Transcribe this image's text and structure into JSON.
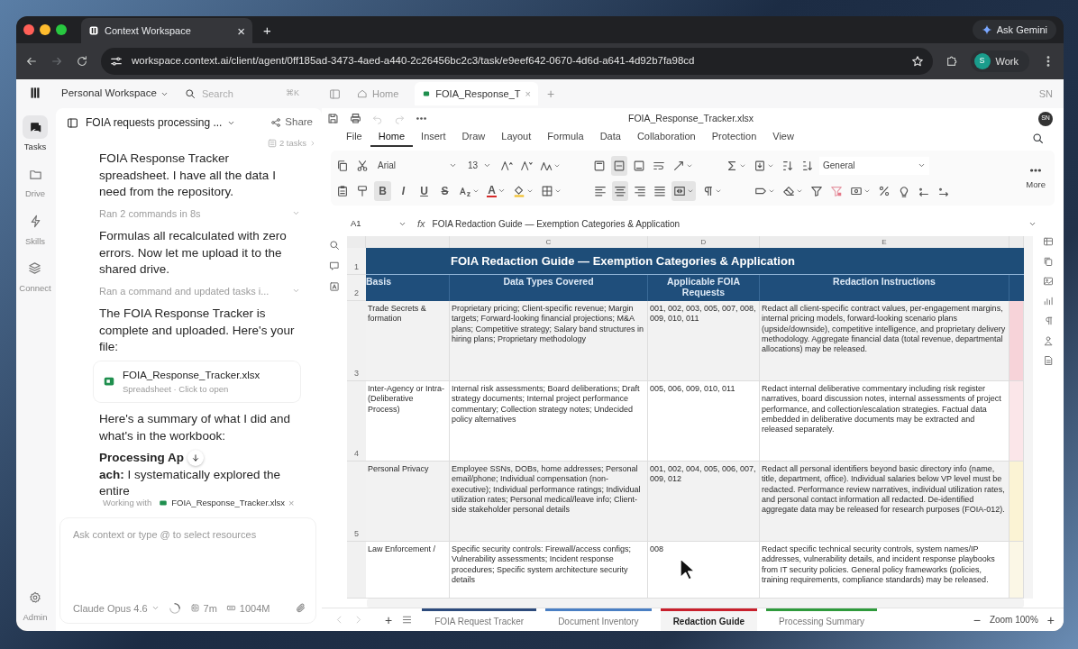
{
  "browser": {
    "tab_title": "Context Workspace",
    "tab_close": "×",
    "new_tab": "+",
    "gemini": "Ask Gemini",
    "url": "workspace.context.ai/client/agent/0ff185ad-3473-4aed-a440-2c26456bc2c3/task/e9eef642-0670-4d6d-a641-4d92b7fa98cd",
    "profile_initial": "S",
    "profile": "Work"
  },
  "rail": {
    "items": [
      {
        "label": "Tasks",
        "selected": true
      },
      {
        "label": "Drive",
        "selected": false
      },
      {
        "label": "Skills",
        "selected": false
      },
      {
        "label": "Connect",
        "selected": false
      }
    ],
    "admin": "Admin"
  },
  "workspace": {
    "name": "Personal Workspace",
    "search_placeholder": "Search",
    "shortcut": "⌘K"
  },
  "chat": {
    "title": "FOIA requests processing ...",
    "share": "Share",
    "tasks_chip": "2 tasks",
    "messages": [
      {
        "kind": "text",
        "text": "FOIA Response Tracker spreadsheet. I have all the data I need from the repository."
      },
      {
        "kind": "activity",
        "text": "Ran 2 commands in 8s"
      },
      {
        "kind": "text",
        "text": "Formulas all recalculated with zero errors. Now let me upload it to the shared drive."
      },
      {
        "kind": "activity",
        "text": "Ran a command and updated tasks i..."
      },
      {
        "kind": "text",
        "text": "The FOIA Response Tracker is complete and uploaded. Here's your file:"
      },
      {
        "kind": "file",
        "name": "FOIA_Response_Tracker.xlsx",
        "meta": "Spreadsheet · Click to open"
      },
      {
        "kind": "text",
        "text": "Here's a summary of what I did and what's in the workbook:"
      },
      {
        "kind": "split",
        "before": "**Processing Ap**",
        "after": "**ach:** I systematically explored the entire"
      }
    ],
    "context_label": "Working with",
    "context_file": "FOIA_Response_Tracker.xlsx",
    "context_close": "×",
    "input_placeholder": "Ask context or type @ to select resources",
    "model": "Claude Opus 4.6",
    "time": "7m",
    "memory": "1004M"
  },
  "app_tabs": [
    {
      "kind": "home",
      "label": "Home",
      "selected": false
    },
    {
      "kind": "file",
      "label": "FOIA_Response_T",
      "close": "×",
      "selected": true
    }
  ],
  "app_new_tab": "+",
  "user_initials": "SN",
  "sheet": {
    "file_name": "FOIA_Response_Tracker.xlsx",
    "avatar": "SN",
    "undo_disabled": true,
    "redo_disabled": true,
    "menu": [
      {
        "label": "File",
        "selected": false
      },
      {
        "label": "Home",
        "selected": true
      },
      {
        "label": "Insert",
        "selected": false
      },
      {
        "label": "Draw",
        "selected": false
      },
      {
        "label": "Layout",
        "selected": false
      },
      {
        "label": "Formula",
        "selected": false
      },
      {
        "label": "Data",
        "selected": false
      },
      {
        "label": "Collaboration",
        "selected": false
      },
      {
        "label": "Protection",
        "selected": false
      },
      {
        "label": "View",
        "selected": false
      }
    ],
    "ribbon_rows": [
      [
        {
          "kind": "icon",
          "selected": false
        },
        {
          "kind": "icon",
          "selected": false
        },
        {
          "kind": "font",
          "value": "Arial"
        },
        {
          "kind": "size",
          "value": "13"
        },
        {
          "kind": "icon",
          "selected": false
        },
        {
          "kind": "icon",
          "selected": false
        },
        {
          "kind": "icon",
          "selected": false,
          "dropdown": true
        },
        {
          "kind": "gap"
        },
        {
          "kind": "icon",
          "selected": false
        },
        {
          "kind": "icon",
          "selected": true
        },
        {
          "kind": "icon",
          "selected": false
        },
        {
          "kind": "icon",
          "selected": false
        },
        {
          "kind": "icon",
          "selected": false,
          "dropdown": true
        },
        {
          "kind": "gap"
        },
        {
          "kind": "icon",
          "selected": false,
          "dropdown": true
        },
        {
          "kind": "icon",
          "selected": false,
          "dropdown": true
        },
        {
          "kind": "icon",
          "selected": false
        },
        {
          "kind": "icon",
          "selected": false
        },
        {
          "kind": "format",
          "value": "General"
        }
      ],
      [
        {
          "kind": "icon",
          "selected": false
        },
        {
          "kind": "icon",
          "selected": false
        },
        {
          "kind": "glyph",
          "text": "B",
          "selected": true
        },
        {
          "kind": "glyph",
          "text": "I",
          "selected": false
        },
        {
          "kind": "glyph",
          "text": "U",
          "selected": false
        },
        {
          "kind": "glyph",
          "text": "S",
          "selected": false
        },
        {
          "kind": "icon",
          "selected": false,
          "dropdown": true
        },
        {
          "kind": "glyph",
          "text": "A",
          "selected": false,
          "dropdown": true,
          "color": "#d62a2a"
        },
        {
          "kind": "icon",
          "selected": false,
          "dropdown": true,
          "color": "#f2c12e"
        },
        {
          "kind": "icon",
          "selected": false,
          "dropdown": true
        },
        {
          "kind": "gap"
        },
        {
          "kind": "icon",
          "selected": false
        },
        {
          "kind": "icon",
          "selected": true
        },
        {
          "kind": "icon",
          "selected": false
        },
        {
          "kind": "icon",
          "selected": false
        },
        {
          "kind": "icon",
          "selected": true,
          "dropdown": true
        },
        {
          "kind": "icon",
          "selected": false,
          "dropdown": true
        },
        {
          "kind": "gap"
        },
        {
          "kind": "icon",
          "selected": false,
          "dropdown": true
        },
        {
          "kind": "icon",
          "selected": false,
          "dropdown": true
        },
        {
          "kind": "icon",
          "selected": false
        },
        {
          "kind": "icon",
          "selected": false
        },
        {
          "kind": "icon",
          "selected": false,
          "dropdown": true
        },
        {
          "kind": "icon",
          "selected": false
        },
        {
          "kind": "icon",
          "selected": false
        },
        {
          "kind": "icon",
          "selected": false
        },
        {
          "kind": "icon",
          "selected": false
        }
      ]
    ],
    "more": "More",
    "name_box": "A1",
    "fx": "fx",
    "formula": "FOIA Redaction Guide — Exemption Categories & Application",
    "column_letters": [
      "C",
      "D",
      "E"
    ],
    "title_row": "1",
    "header_row": "2",
    "title": "FOIA Redaction Guide — Exemption Categories & Application",
    "headers": [
      "Basis",
      "Data Types Covered",
      "Applicable FOIA Requests",
      "Redaction Instructions"
    ],
    "rows": [
      {
        "number": "3",
        "shaded": true,
        "color": "#f7d3d9",
        "cells": [
          "Trade Secrets & formation",
          "Proprietary pricing; Client-specific revenue; Margin targets; Forward-looking financial projections; M&A plans; Competitive strategy; Salary band structures in hiring plans; Proprietary methodology",
          "001, 002, 003, 005, 007, 008, 009, 010, 011",
          "Redact all client-specific contract values, per-engagement margins, internal pricing models, forward-looking scenario plans (upside/downside), competitive intelligence, and proprietary delivery methodology. Aggregate financial data (total revenue, departmental allocations) may be released."
        ]
      },
      {
        "number": "4",
        "shaded": false,
        "color": "#fbe6e9",
        "cells": [
          "Inter-Agency or Intra- (Deliberative Process)",
          "Internal risk assessments; Board deliberations; Draft strategy documents; Internal project performance commentary; Collection strategy notes; Undecided policy alternatives",
          "005, 006, 009, 010, 011",
          "Redact internal deliberative commentary including risk register narratives, board discussion notes, internal assessments of project performance, and collection/escalation strategies. Factual data embedded in deliberative documents may be extracted and released separately."
        ]
      },
      {
        "number": "5",
        "shaded": true,
        "color": "#fbf3d4",
        "cells": [
          "Personal Privacy",
          "Employee SSNs, DOBs, home addresses; Personal email/phone; Individual compensation (non-executive); Individual performance ratings; Individual utilization rates; Personal medical/leave info; Client-side stakeholder personal details",
          "001, 002, 004, 005, 006, 007, 009, 012",
          "Redact all personal identifiers beyond basic directory info (name, title, department, office). Individual salaries below VP level must be redacted. Performance review narratives, individual utilization rates, and personal contact information all redacted. De-identified aggregate data may be released for research purposes (FOIA-012)."
        ]
      },
      {
        "shaded": false,
        "color": "#fbf7e6",
        "cells": [
          "Law Enforcement /",
          "Specific security controls: Firewall/access configs; Vulnerability assessments; Incident response procedures; Specific system architecture security details",
          "008",
          "Redact specific technical security controls, system names/IP addresses, vulnerability details, and incident response playbooks from IT security policies. General policy frameworks (policies, training requirements, compliance standards) may be released."
        ]
      }
    ],
    "add_sheet": "+",
    "sheet_tabs": [
      {
        "label": "FOIA Request Tracker",
        "color": "#2d4b7c",
        "selected": false
      },
      {
        "label": "Document Inventory",
        "color": "#4a7fc3",
        "selected": false
      },
      {
        "label": "Redaction Guide",
        "color": "#c8202c",
        "selected": true
      },
      {
        "label": "Processing Summary",
        "color": "#2f9a3c",
        "selected": false
      }
    ],
    "zoom_out": "−",
    "zoom": "Zoom 100%",
    "zoom_in": "+"
  }
}
